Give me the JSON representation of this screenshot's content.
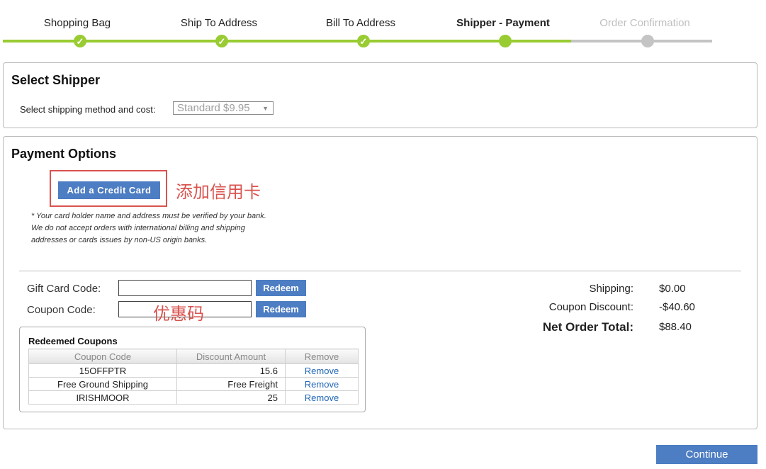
{
  "steps": [
    {
      "label": "Shopping Bag",
      "state": "done",
      "mark": "✓"
    },
    {
      "label": "Ship To Address",
      "state": "done",
      "mark": "✓"
    },
    {
      "label": "Bill To Address",
      "state": "done",
      "mark": "✓"
    },
    {
      "label": "Shipper - Payment",
      "state": "current",
      "mark": ""
    },
    {
      "label": "Order Confirmation",
      "state": "pending",
      "mark": ""
    }
  ],
  "select_shipper": {
    "title": "Select Shipper",
    "method_label": "Select shipping method and cost:",
    "method_value": "Standard $9.95",
    "caret": "▼"
  },
  "payment": {
    "title": "Payment Options",
    "add_card_label": "Add a Credit Card",
    "annotation_card": "添加信用卡",
    "disclaimer": "* Your card holder name and address must be verified by your bank. We do not accept orders with international billing and shipping addresses or cards issues by non-US origin banks.",
    "gift_card_label": "Gift Card Code:",
    "gift_card_value": "",
    "coupon_label": "Coupon Code:",
    "coupon_value": "",
    "redeem_label": "Redeem",
    "annotation_coupon": "优惠码"
  },
  "totals": {
    "shipping_label": "Shipping:",
    "shipping_value": "$0.00",
    "discount_label": "Coupon Discount:",
    "discount_value": "-$40.60",
    "net_label": "Net Order Total:",
    "net_value": "$88.40"
  },
  "redeemed": {
    "title": "Redeemed Coupons",
    "columns": [
      "Coupon Code",
      "Discount Amount",
      "Remove"
    ],
    "rows": [
      {
        "code": "15OFFPTR",
        "amount": "15.6",
        "remove": "Remove"
      },
      {
        "code": "Free Ground Shipping",
        "amount": "Free Freight",
        "remove": "Remove"
      },
      {
        "code": "IRISHMOOR",
        "amount": "25",
        "remove": "Remove"
      }
    ]
  },
  "continue_label": "Continue",
  "colors": {
    "progress_done": "#99cc33",
    "progress_pending": "#c4c4c4",
    "button_blue": "#4d7dc2",
    "annotation_red": "#d9534f",
    "link_blue": "#2166b8"
  }
}
